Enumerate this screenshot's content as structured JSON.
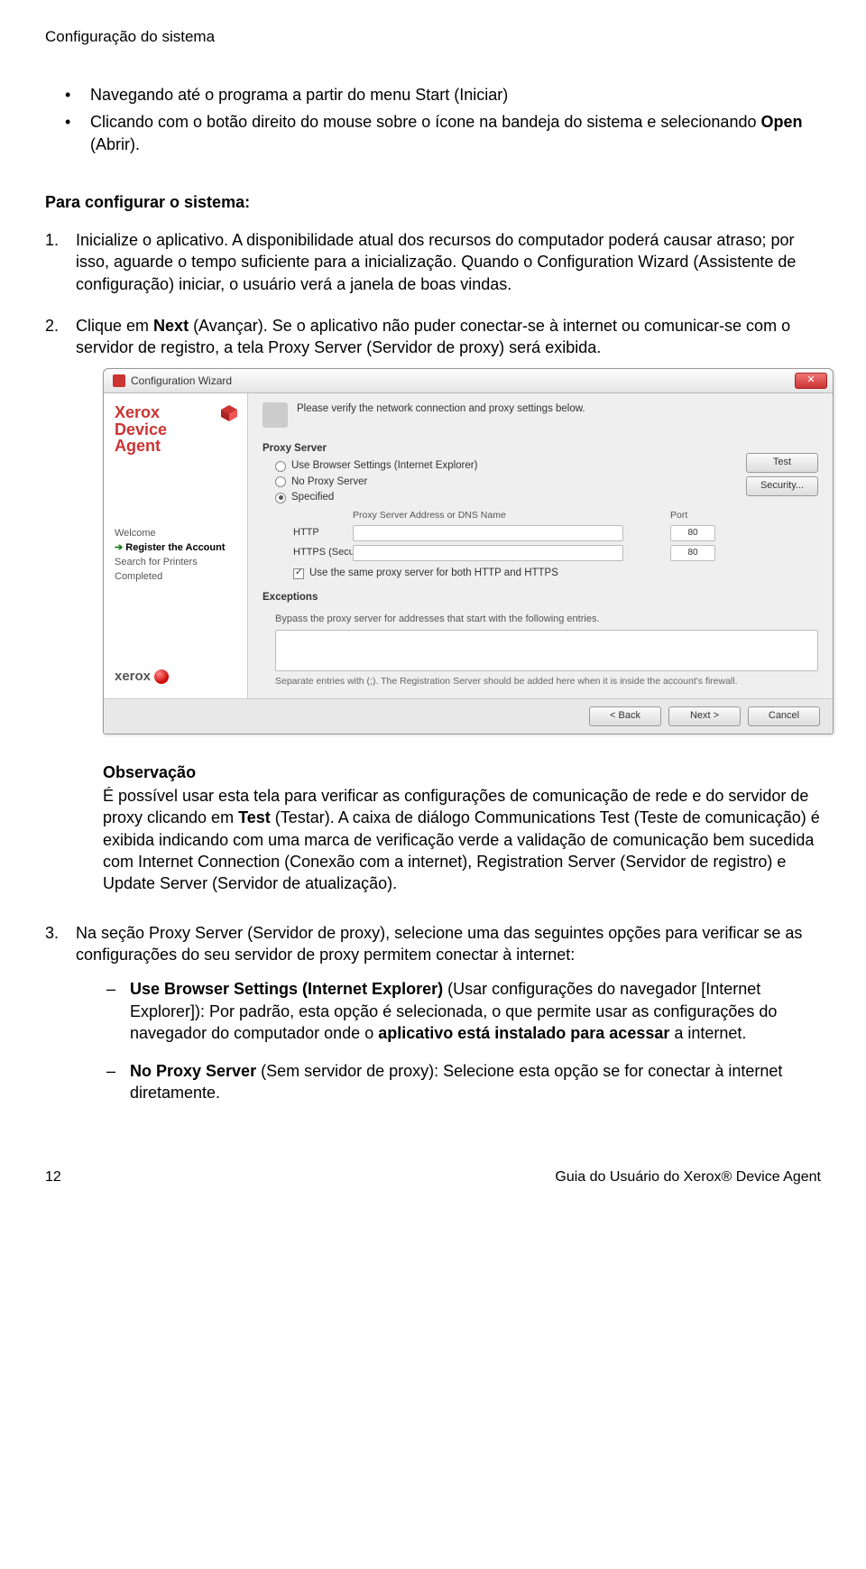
{
  "header": "Configuração do sistema",
  "bullets": {
    "b1_a": "Navegando até o programa a partir do menu Start (Iniciar)",
    "b2_a": "Clicando com o botão direito do mouse sobre o ícone na bandeja do sistema e selecionando ",
    "b2_b": "Open",
    "b2_c": " (Abrir)."
  },
  "section_head": "Para configurar o sistema:",
  "step1": "Inicialize o aplicativo. A disponibilidade atual dos recursos do computador poderá causar atraso; por isso, aguarde o tempo suficiente para a inicialização. Quando o Configuration Wizard (Assistente de configuração) iniciar, o usuário verá a janela de boas vindas.",
  "step2_a": "Clique em ",
  "step2_b": "Next",
  "step2_c": " (Avançar). Se o aplicativo não puder conectar-se à internet ou comunicar-se com o servidor de registro, a tela Proxy Server (Servidor de proxy) será exibida.",
  "wizard": {
    "title": "Configuration Wizard",
    "brand": {
      "l1": "Xerox",
      "l2": "Device",
      "l3": "Agent"
    },
    "steps": {
      "s1": "Welcome",
      "s2": "Register the Account",
      "s3": "Search for Printers",
      "s4": "Completed"
    },
    "xerox": "xerox",
    "instruction": "Please verify the network connection and proxy settings below.",
    "group_proxy": "Proxy Server",
    "opt_browser": "Use Browser Settings (Internet Explorer)",
    "opt_noproxy": "No Proxy Server",
    "opt_specified": "Specified",
    "addr_label": "Proxy Server Address or DNS Name",
    "port_label": "Port",
    "http": "HTTP",
    "https": "HTTPS (Secure)",
    "port_http": "80",
    "port_https": "80",
    "same_proxy": "Use the same proxy server for both HTTP and HTTPS",
    "btn_test": "Test",
    "btn_security": "Security...",
    "group_exc": "Exceptions",
    "exc_text": "Bypass the proxy server for addresses that start with the following entries.",
    "exc_note": "Separate entries with (;). The Registration Server should be added here when it is inside the account's firewall.",
    "btn_back": "< Back",
    "btn_next": "Next >",
    "btn_cancel": "Cancel"
  },
  "obs": {
    "head": "Observação",
    "p_a": "É possível usar esta tela para verificar as configurações de comunicação de rede e do servidor de proxy clicando em ",
    "p_b": "Test",
    "p_c": " (Testar). A caixa de diálogo Communications Test (Teste de comunicação) é exibida indicando com uma marca de verificação verde a validação de comunicação bem sucedida com Internet Connection (Conexão com a internet), Registration Server (Servidor de registro) e Update Server (Servidor de atualização)."
  },
  "step3": "Na seção Proxy Server (Servidor de proxy), selecione uma das seguintes opções para verificar se as configurações do seu servidor de proxy permitem conectar à internet:",
  "sub1_a": "Use Browser Settings (Internet Explorer)",
  "sub1_b": " (Usar configurações do navegador [Internet Explorer]): Por padrão, esta opção é selecionada, o que permite usar as configurações do navegador do computador onde o ",
  "sub1_c": "aplicativo está instalado para acessar",
  "sub1_d": " a internet.",
  "sub2_a": "No Proxy Server",
  "sub2_b": " (Sem servidor de proxy): Selecione esta opção se for conectar à internet diretamente.",
  "footer": {
    "page": "12",
    "guide": "Guia do Usuário do Xerox® Device Agent"
  }
}
